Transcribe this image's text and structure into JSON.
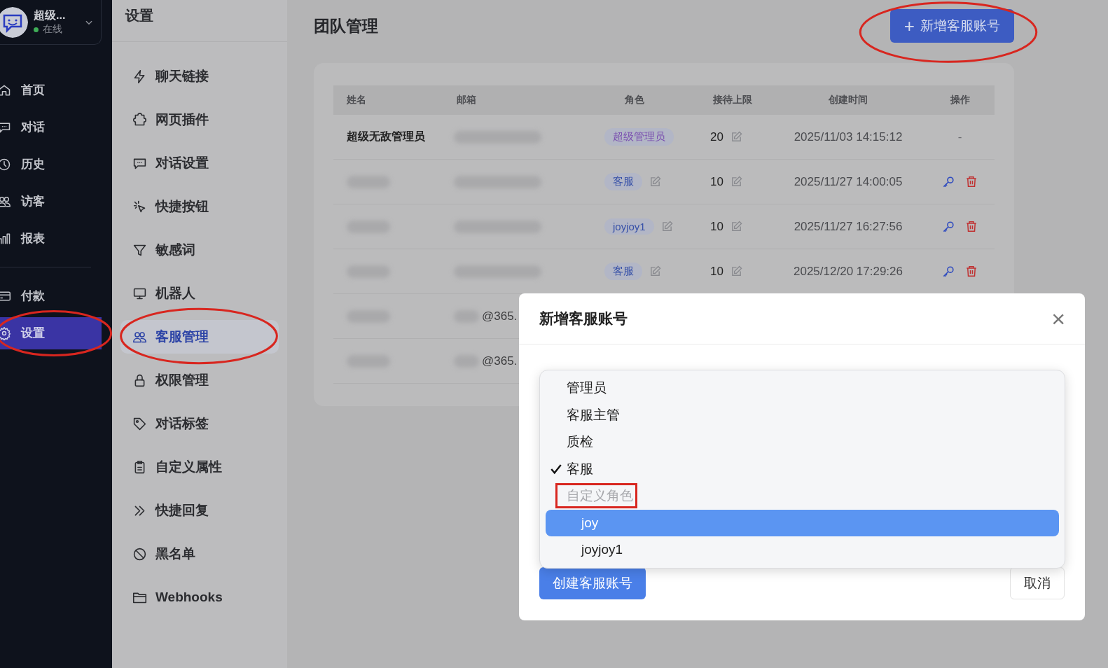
{
  "sidebar": {
    "user": {
      "name": "超级...",
      "status": "在线",
      "online": true
    },
    "items": [
      {
        "label": "首页",
        "selected": false
      },
      {
        "label": "对话",
        "selected": false
      },
      {
        "label": "历史",
        "selected": false
      },
      {
        "label": "访客",
        "selected": false
      },
      {
        "label": "报表",
        "selected": false
      },
      {
        "label": "付款",
        "selected": false,
        "divider_before": true
      },
      {
        "label": "设置",
        "selected": true,
        "annotated": true
      }
    ]
  },
  "settings_nav": {
    "title": "设置",
    "items": [
      {
        "label": "聊天链接",
        "selected": false
      },
      {
        "label": "网页插件",
        "selected": false
      },
      {
        "label": "对话设置",
        "selected": false
      },
      {
        "label": "快捷按钮",
        "selected": false
      },
      {
        "label": "敏感词",
        "selected": false
      },
      {
        "label": "机器人",
        "selected": false
      },
      {
        "label": "客服管理",
        "selected": true,
        "annotated": true
      },
      {
        "label": "权限管理",
        "selected": false
      },
      {
        "label": "对话标签",
        "selected": false
      },
      {
        "label": "自定义属性",
        "selected": false
      },
      {
        "label": "快捷回复",
        "selected": false
      },
      {
        "label": "黑名单",
        "selected": false
      },
      {
        "label": "Webhooks",
        "selected": false
      }
    ]
  },
  "page": {
    "title": "团队管理",
    "add_button": {
      "icon": "+",
      "label": "新增客服账号",
      "annotated": true
    }
  },
  "table": {
    "columns": [
      "姓名",
      "邮箱",
      "角色",
      "接待上限",
      "创建时间",
      "操作"
    ],
    "rows": [
      {
        "name": "超级无敌管理员",
        "name_blurred": false,
        "email_blurred": true,
        "role": {
          "label": "超级管理员",
          "color": "#7a4fb0"
        },
        "role_editable": false,
        "limit": "20",
        "created": "2025/11/03 14:15:12",
        "kind": "owner",
        "action": "-"
      },
      {
        "name_blurred": true,
        "email_blurred": true,
        "role": {
          "label": "客服",
          "color": "#3650a8"
        },
        "role_editable": true,
        "limit": "10",
        "created": "2025/11/27 14:00:05",
        "kind": "member"
      },
      {
        "name_blurred": true,
        "email_blurred": true,
        "role": {
          "label": "joyjoy1",
          "color": "#3650a8"
        },
        "role_editable": true,
        "limit": "10",
        "created": "2025/11/27 16:27:56",
        "kind": "member"
      },
      {
        "name_blurred": true,
        "email_blurred": true,
        "role": {
          "label": "客服",
          "color": "#3650a8"
        },
        "role_editable": true,
        "limit": "10",
        "created": "2025/12/20 17:29:26",
        "kind": "member"
      },
      {
        "name_blurred": true,
        "email_blurred": true,
        "email_suffix": "@365."
      },
      {
        "name_blurred": true,
        "email_blurred": true,
        "email_suffix": "@365."
      }
    ]
  },
  "modal": {
    "title": "新增客服账号",
    "close": "×",
    "role_dropdown": {
      "options": [
        {
          "label": "管理员",
          "kind": "option",
          "selected": false,
          "highlighted": false
        },
        {
          "label": "客服主管",
          "kind": "option",
          "selected": false,
          "highlighted": false
        },
        {
          "label": "质检",
          "kind": "option",
          "selected": false,
          "highlighted": false
        },
        {
          "label": "客服",
          "kind": "option",
          "selected": true,
          "highlighted": false
        },
        {
          "label": "自定义角色",
          "kind": "group",
          "annotated": true,
          "children": [
            {
              "label": "joy",
              "kind": "option",
              "selected": false,
              "highlighted": true
            },
            {
              "label": "joyjoy1",
              "kind": "option",
              "selected": false,
              "highlighted": false
            }
          ]
        }
      ]
    },
    "buttons": [
      {
        "label": "创建客服账号",
        "kind": "primary"
      },
      {
        "label": "取消",
        "kind": "secondary"
      }
    ]
  }
}
